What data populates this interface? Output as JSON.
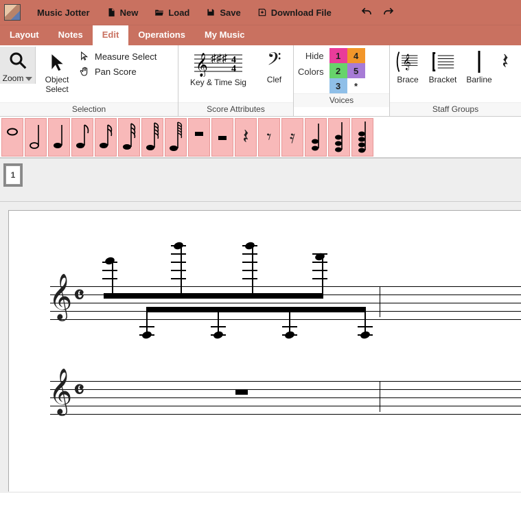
{
  "app": {
    "title": "Music Jotter"
  },
  "topbar": {
    "new": "New",
    "load": "Load",
    "save": "Save",
    "download": "Download File"
  },
  "tabs": [
    {
      "label": "Layout",
      "active": false
    },
    {
      "label": "Notes",
      "active": false
    },
    {
      "label": "Edit",
      "active": true
    },
    {
      "label": "Operations",
      "active": false
    },
    {
      "label": "My Music",
      "active": false
    }
  ],
  "ribbon": {
    "selection": {
      "title": "Selection",
      "zoom": "Zoom",
      "object_select": "Object Select",
      "measure_select": "Measure Select",
      "pan_score": "Pan Score"
    },
    "score_attrs": {
      "title": "Score Attributes",
      "key_time": "Key & Time Sig",
      "clef": "Clef"
    },
    "voices": {
      "title": "Voices",
      "hide": "Hide",
      "colors": "Colors",
      "cells": [
        "1",
        "4",
        "2",
        "5",
        "3",
        "*"
      ]
    },
    "staff_groups": {
      "title": "Staff Groups",
      "brace": "Brace",
      "bracket": "Bracket",
      "barline": "Barline"
    }
  },
  "palette": {
    "items": [
      "whole-note",
      "half-note",
      "quarter-note",
      "eighth-note",
      "sixteenth-note",
      "thirtysecond-note",
      "sixtyfourth-note",
      "hundredtwentyeighth-note",
      "whole-rest",
      "half-rest",
      "quarter-rest",
      "eighth-rest",
      "sixteenth-rest",
      "chord-2",
      "chord-3",
      "chord-4"
    ]
  },
  "pages": {
    "current": "1"
  },
  "score": {
    "staves": [
      {
        "clef": "𝄞",
        "time": "𝄴",
        "content": "notes"
      },
      {
        "clef": "𝄞",
        "time": "𝄴",
        "content": "rest"
      }
    ]
  }
}
